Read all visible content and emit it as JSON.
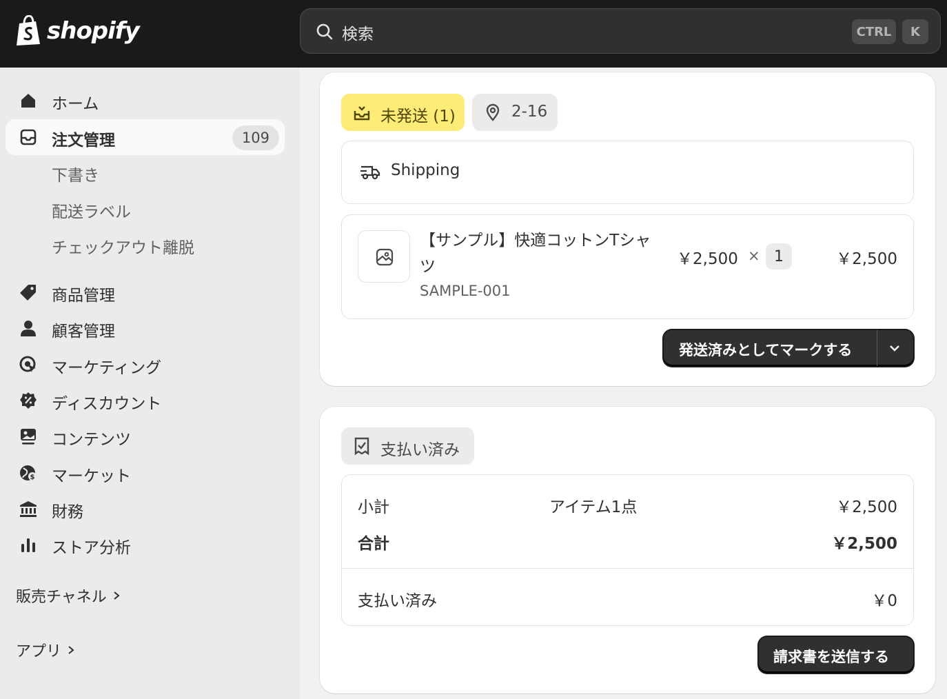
{
  "app": {
    "brand": "shopify"
  },
  "search": {
    "placeholder": "検索",
    "shortcut_ctrl": "CTRL",
    "shortcut_k": "K"
  },
  "sidebar": {
    "home": "ホーム",
    "orders": {
      "label": "注文管理",
      "badge": "109"
    },
    "order_subitems": [
      "下書き",
      "配送ラベル",
      "チェックアウト離脱"
    ],
    "items": [
      {
        "label": "商品管理",
        "icon": "tag-icon"
      },
      {
        "label": "顧客管理",
        "icon": "person-icon"
      },
      {
        "label": "マーケティング",
        "icon": "target-icon"
      },
      {
        "label": "ディスカウント",
        "icon": "discount-icon"
      },
      {
        "label": "コンテンツ",
        "icon": "image-icon"
      },
      {
        "label": "マーケット",
        "icon": "globe-icon"
      },
      {
        "label": "財務",
        "icon": "bank-icon"
      },
      {
        "label": "ストア分析",
        "icon": "bar-chart-icon"
      }
    ],
    "sales_channels": "販売チャネル",
    "apps": "アプリ"
  },
  "fulfillment": {
    "status": "未発送 (1)",
    "location": "2-16",
    "shipping_label": "Shipping",
    "item": {
      "title": "【サンプル】快適コットンTシャツ",
      "sku": "SAMPLE-001",
      "price": "￥2,500",
      "times": "×",
      "qty": "1",
      "total": "￥2,500"
    },
    "mark_button": "発送済みとしてマークする"
  },
  "payment": {
    "status": "支払い済み",
    "subtotal_label": "小計",
    "subtotal_items": "アイテム1点",
    "subtotal_value": "￥2,500",
    "total_label": "合計",
    "total_value": "￥2,500",
    "paid_label": "支払い済み",
    "paid_value": "￥0",
    "invoice_button": "請求書を送信する"
  },
  "colors": {
    "topbar": "#1a1a1a",
    "unfulfilled_badge": "#ffeb78",
    "button": "#303030"
  }
}
